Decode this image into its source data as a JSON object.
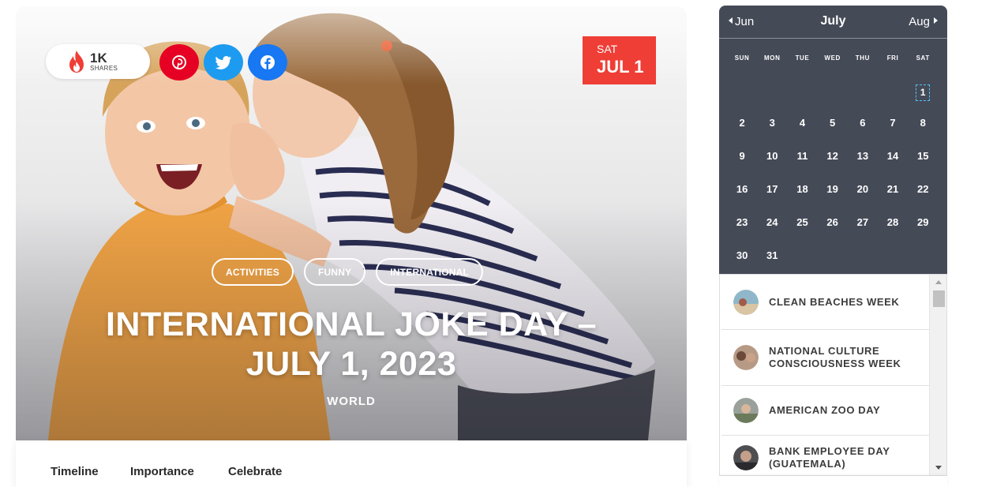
{
  "hero": {
    "shares": {
      "count": "1K",
      "label": "SHARES",
      "icon": "flame-icon",
      "color": "#ef3e36"
    },
    "social": [
      {
        "name": "pinterest",
        "icon": "pinterest-icon",
        "color": "#e60023"
      },
      {
        "name": "twitter",
        "icon": "twitter-icon",
        "color": "#1d9bf0"
      },
      {
        "name": "facebook",
        "icon": "facebook-icon",
        "color": "#1877f2"
      }
    ],
    "date_badge": {
      "dow": "SAT",
      "date": "JUL 1",
      "color": "#ef3e36"
    },
    "tags": [
      "ACTIVITIES",
      "FUNNY",
      "INTERNATIONAL"
    ],
    "title_line1": "INTERNATIONAL JOKE DAY –",
    "title_line2": "JULY 1, 2023",
    "category": "WORLD"
  },
  "tabs": [
    "Timeline",
    "Importance",
    "Celebrate"
  ],
  "calendar": {
    "prev": "Jun",
    "month": "July",
    "next": "Aug",
    "weekdays": [
      "SUN",
      "MON",
      "TUE",
      "WED",
      "THU",
      "FRI",
      "SAT"
    ],
    "weeks": [
      [
        "",
        "",
        "",
        "",
        "",
        "",
        "1"
      ],
      [
        "2",
        "3",
        "4",
        "5",
        "6",
        "7",
        "8"
      ],
      [
        "9",
        "10",
        "11",
        "12",
        "13",
        "14",
        "15"
      ],
      [
        "16",
        "17",
        "18",
        "19",
        "20",
        "21",
        "22"
      ],
      [
        "23",
        "24",
        "25",
        "26",
        "27",
        "28",
        "29"
      ],
      [
        "30",
        "31",
        "",
        "",
        "",
        "",
        ""
      ]
    ],
    "today": "1",
    "bg_color": "#454a57"
  },
  "events": [
    {
      "name": "CLEAN BEACHES WEEK"
    },
    {
      "name": "NATIONAL CULTURE CONSCIOUSNESS WEEK"
    },
    {
      "name": "AMERICAN ZOO DAY"
    },
    {
      "name": "BANK EMPLOYEE DAY (GUATEMALA)"
    }
  ]
}
